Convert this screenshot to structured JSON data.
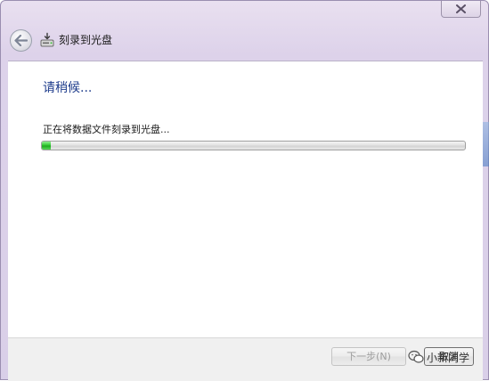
{
  "window": {
    "title": "刻录到光盘",
    "close_symbol": "✕"
  },
  "content": {
    "heading": "请稍候...",
    "status": "正在将数据文件刻录到光盘...",
    "progress": 0.02
  },
  "footer": {
    "next_label": "下一步(N)",
    "cancel_label": "取消"
  },
  "watermark": {
    "text": "小新同学"
  },
  "icons": [
    "back-arrow-icon",
    "disc-burn-icon",
    "close-icon",
    "wechat-icon"
  ]
}
